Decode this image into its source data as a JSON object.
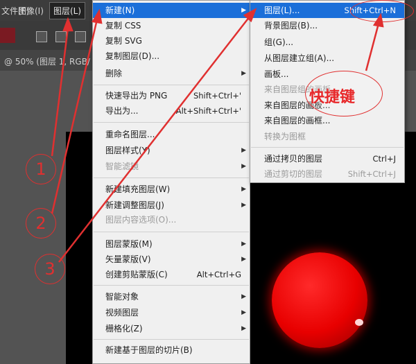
{
  "menubar": {
    "items": [
      {
        "label": "文件(F)"
      },
      {
        "label": "图像(I)"
      },
      {
        "label": "图层(L)"
      }
    ]
  },
  "document_tab": {
    "label": "@ 50% (图层 1, RGB/"
  },
  "layer_menu": {
    "items": [
      {
        "label": "新建(N)",
        "submenu": true,
        "highlight": true
      },
      {
        "label": "复制 CSS"
      },
      {
        "label": "复制 SVG"
      },
      {
        "label": "复制图层(D)..."
      },
      {
        "label": "删除",
        "submenu": true
      },
      {
        "label": "快速导出为 PNG",
        "shortcut": "Shift+Ctrl+'"
      },
      {
        "label": "导出为...",
        "shortcut": "Alt+Shift+Ctrl+'"
      },
      {
        "label": "重命名图层..."
      },
      {
        "label": "图层样式(Y)",
        "submenu": true
      },
      {
        "label": "智能滤镜",
        "submenu": true,
        "disabled": true
      },
      {
        "label": "新建填充图层(W)",
        "submenu": true
      },
      {
        "label": "新建调整图层(J)",
        "submenu": true
      },
      {
        "label": "图层内容选项(O)...",
        "disabled": true
      },
      {
        "label": "图层蒙版(M)",
        "submenu": true
      },
      {
        "label": "矢量蒙版(V)",
        "submenu": true
      },
      {
        "label": "创建剪贴蒙版(C)",
        "shortcut": "Alt+Ctrl+G"
      },
      {
        "label": "智能对象",
        "submenu": true
      },
      {
        "label": "视频图层",
        "submenu": true
      },
      {
        "label": "栅格化(Z)",
        "submenu": true
      },
      {
        "label": "新建基于图层的切片(B)"
      }
    ]
  },
  "new_submenu": {
    "items": [
      {
        "label": "图层(L)...",
        "shortcut": "Shift+Ctrl+N",
        "highlight": true
      },
      {
        "label": "背景图层(B)..."
      },
      {
        "label": "组(G)..."
      },
      {
        "label": "从图层建立组(A)..."
      },
      {
        "label": "画板..."
      },
      {
        "label": "来自图层组的画板...",
        "disabled": true
      },
      {
        "label": "来自图层的画板..."
      },
      {
        "label": "来自图层的画框..."
      },
      {
        "label": "转换为图框",
        "disabled": true
      },
      {
        "label": "通过拷贝的图层",
        "shortcut": "Ctrl+J"
      },
      {
        "label": "通过剪切的图层",
        "shortcut": "Shift+Ctrl+J",
        "disabled": true
      }
    ]
  },
  "annotations": {
    "steps": [
      "1",
      "2",
      "3"
    ],
    "shortcut_note": "快捷键",
    "color": "#e03030"
  },
  "colors": {
    "highlight": "#1b6fd9",
    "menu_bg": "#f0f0f0",
    "canvas": "#000000",
    "ball": "#e80000"
  }
}
